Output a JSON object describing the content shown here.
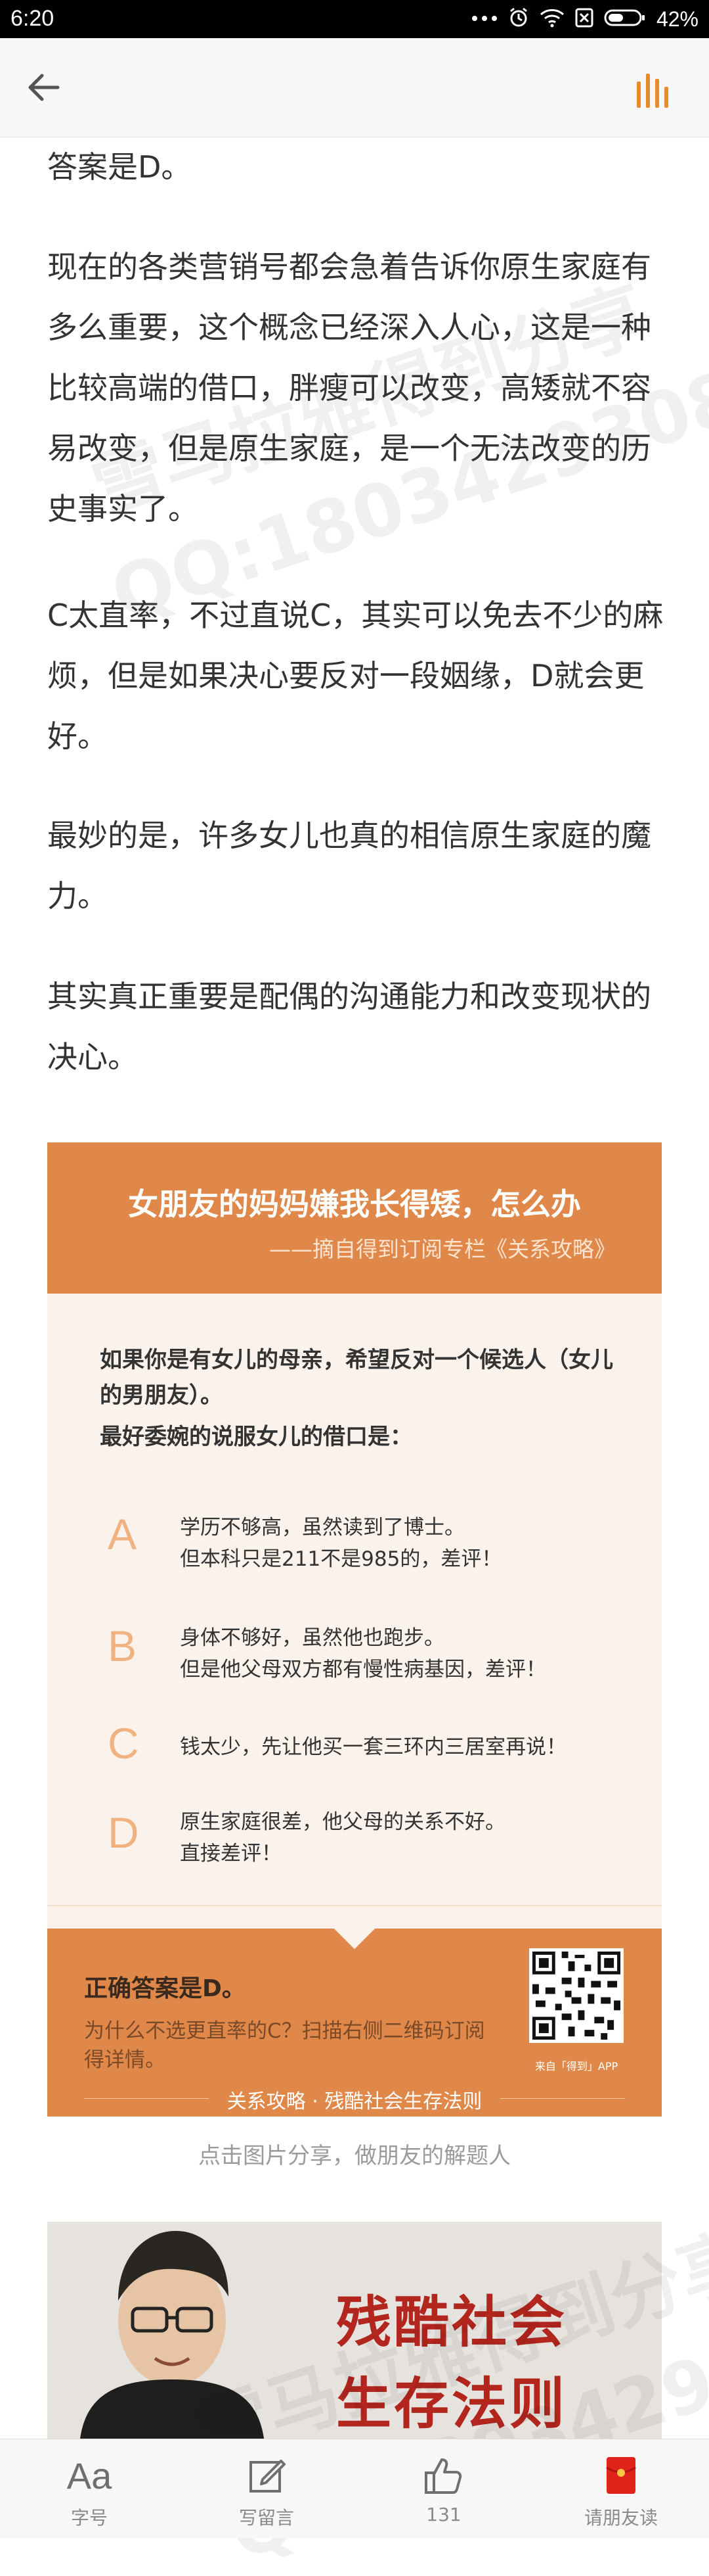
{
  "status_bar": {
    "time": "6:20",
    "battery_percent": "42%"
  },
  "article": {
    "paragraphs": [
      "答案是D。",
      "现在的各类营销号都会急着告诉你原生家庭有多么重要，这个概念已经深入人心，这是一种比较高端的借口，胖瘦可以改变，高矮就不容易改变，但是原生家庭，是一个无法改变的历史事实了。",
      "C太直率，不过直说C，其实可以免去不少的麻烦，但是如果决心要反对一段姻缘，D就会更好。",
      "最妙的是，许多女儿也真的相信原生家庭的魔力。",
      "其实真正重要是配偶的沟通能力和改变现状的决心。"
    ]
  },
  "card": {
    "title": "女朋友的妈妈嫌我长得矮，怎么办",
    "subtitle": "——摘自得到订阅专栏《关系攻略》",
    "question": "如果你是有女儿的母亲，希望反对一个候选人（女儿的男朋友）。",
    "prompt": "最好委婉的说服女儿的借口是：",
    "options": [
      {
        "letter": "A",
        "lines": [
          "学历不够高，虽然读到了博士。",
          "但本科只是211不是985的，差评！"
        ]
      },
      {
        "letter": "B",
        "lines": [
          "身体不够好，虽然他也跑步。",
          "但是他父母双方都有慢性病基因，差评！"
        ]
      },
      {
        "letter": "C",
        "lines": [
          "钱太少，先让他买一套三环内三居室再说！"
        ]
      },
      {
        "letter": "D",
        "lines": [
          "原生家庭很差，他父母的关系不好。",
          "直接差评！"
        ]
      }
    ],
    "answer": "正确答案是D。",
    "scan_text": "为什么不选更直率的C？扫描右侧二维码订阅得详情。",
    "qr_caption": "来自「得到」APP",
    "footer_brand": "关系攻略 · 残酷社会生存法则",
    "accent_color": "#e0884a",
    "letter_color": "#f0b280"
  },
  "card_caption": "点击图片分享，做朋友的解题人",
  "banner": {
    "title_line1": "残酷社会",
    "title_line2": "生存法则",
    "title_color": "#b3261e"
  },
  "watermark": {
    "line1": "雪马拉雅得到分享",
    "line2": "QQ:1803429308"
  },
  "toolbar": {
    "items": [
      {
        "icon": "font-size-icon",
        "glyph": "Aa",
        "label": "字号"
      },
      {
        "icon": "compose-icon",
        "label": "写留言"
      },
      {
        "icon": "thumbs-up-icon",
        "label": "131"
      },
      {
        "icon": "red-envelope-icon",
        "label": "请朋友读"
      }
    ]
  },
  "nav": {
    "back_icon": "back-arrow-icon",
    "menu_icon": "columns-icon",
    "accent_color": "#e98a2e"
  }
}
